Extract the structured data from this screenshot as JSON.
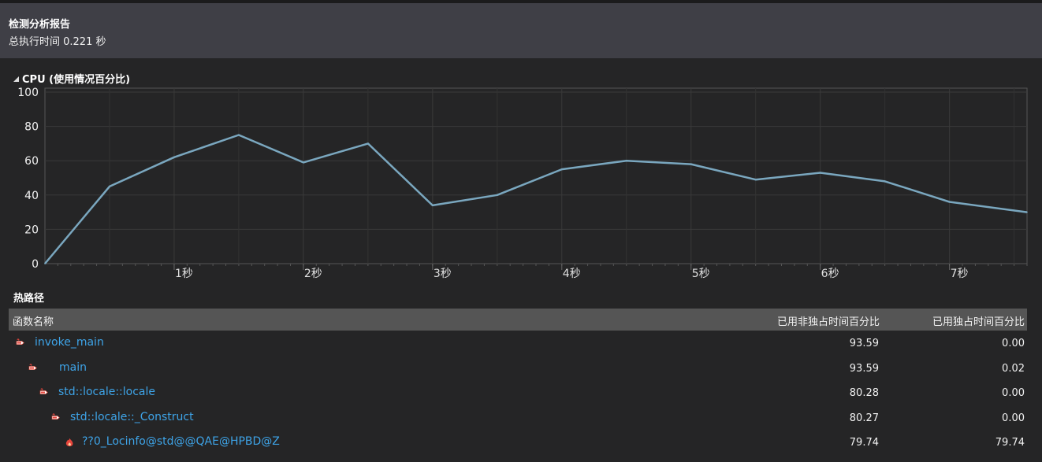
{
  "header": {
    "title": "检测分析报告",
    "total_time": "总执行时间 0.221 秒"
  },
  "cpu_section": {
    "title": "CPU (使用情况百分比)"
  },
  "chart_data": {
    "type": "line",
    "title": "CPU (使用情况百分比)",
    "xlabel": "",
    "ylabel": "",
    "xlim": [
      0,
      7.6
    ],
    "ylim": [
      0,
      100
    ],
    "yticks": [
      0,
      20,
      40,
      60,
      80,
      100
    ],
    "xticks": [
      {
        "value": 1,
        "label": "1秒"
      },
      {
        "value": 2,
        "label": "2秒"
      },
      {
        "value": 3,
        "label": "3秒"
      },
      {
        "value": 4,
        "label": "4秒"
      },
      {
        "value": 5,
        "label": "5秒"
      },
      {
        "value": 6,
        "label": "6秒"
      },
      {
        "value": 7,
        "label": "7秒"
      }
    ],
    "grid": true,
    "series": [
      {
        "line_color": "#7aa7bf",
        "x": [
          0,
          0.5,
          1,
          1.5,
          2,
          2.5,
          3,
          3.5,
          4,
          4.5,
          5,
          5.5,
          6,
          6.5,
          7,
          7.6
        ],
        "values": [
          0,
          45,
          62,
          75,
          59,
          70,
          34,
          40,
          55,
          60,
          58,
          49,
          53,
          48,
          36,
          30
        ]
      }
    ]
  },
  "hot_path": {
    "title": "热路径",
    "columns": [
      "函数名称",
      "已用非独占时间百分比",
      "已用独占时间百分比"
    ],
    "rows": [
      {
        "name": "invoke_main",
        "inclusive": "93.59",
        "exclusive": "0.00",
        "icon": "hot-path-arrow-icon"
      },
      {
        "name": "main",
        "inclusive": "93.59",
        "exclusive": "0.02",
        "icon": "hot-path-arrow-icon"
      },
      {
        "name": "std::locale::locale",
        "inclusive": "80.28",
        "exclusive": "0.00",
        "icon": "hot-path-arrow-icon"
      },
      {
        "name": "std::locale::_Construct",
        "inclusive": "80.27",
        "exclusive": "0.00",
        "icon": "hot-path-arrow-icon"
      },
      {
        "name": "??0_Locinfo@std@@QAE@HPBD@Z",
        "inclusive": "79.74",
        "exclusive": "79.74",
        "icon": "flame-icon"
      }
    ]
  },
  "colors": {
    "link": "#3ea4e8",
    "series_line": "#7aa7bf",
    "header_bg": "#3f3f46",
    "body_bg": "#252526"
  }
}
